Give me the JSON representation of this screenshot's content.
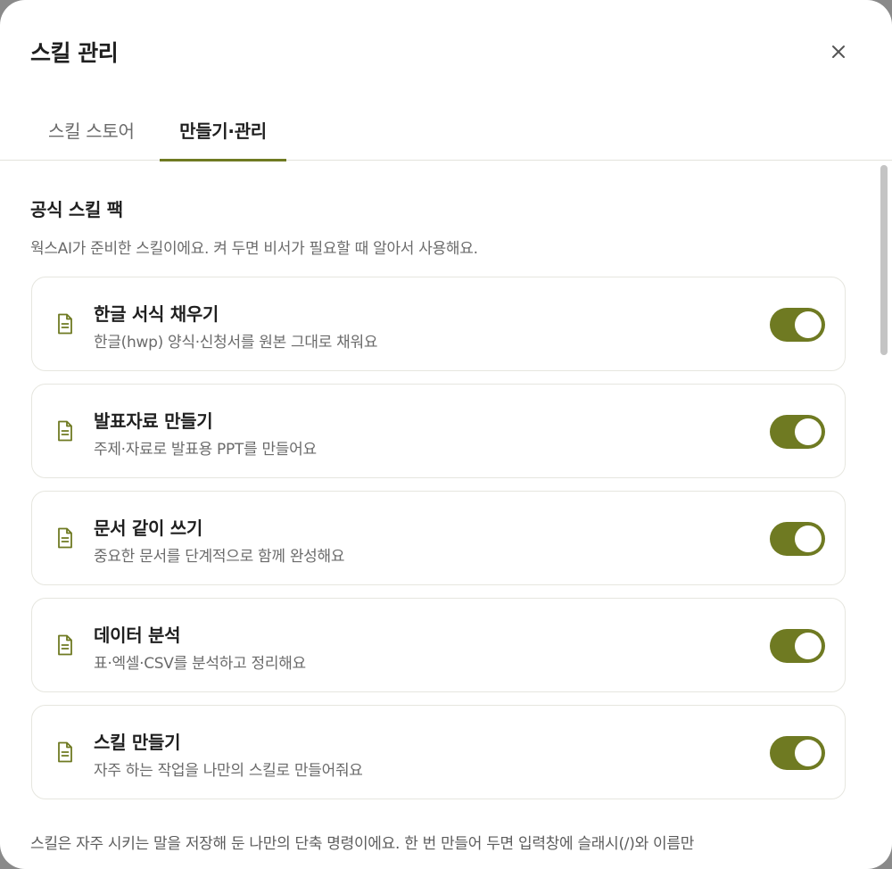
{
  "header": {
    "title": "스킬 관리",
    "close_icon": "close-icon"
  },
  "tabs": [
    {
      "label": "스킬 스토어",
      "active": false
    },
    {
      "label": "만들기·관리",
      "active": true
    }
  ],
  "section": {
    "title": "공식 스킬 팩",
    "description": "웍스AI가 준비한 스킬이에요. 켜 두면 비서가 필요할 때 알아서 사용해요."
  },
  "skills": [
    {
      "name": "한글 서식 채우기",
      "description": "한글(hwp) 양식·신청서를 원본 그대로 채워요",
      "enabled": true
    },
    {
      "name": "발표자료 만들기",
      "description": "주제·자료로 발표용 PPT를 만들어요",
      "enabled": true
    },
    {
      "name": "문서 같이 쓰기",
      "description": "중요한 문서를 단계적으로 함께 완성해요",
      "enabled": true
    },
    {
      "name": "데이터 분석",
      "description": "표·엑셀·CSV를 분석하고 정리해요",
      "enabled": true
    },
    {
      "name": "스킬 만들기",
      "description": "자주 하는 작업을 나만의 스킬로 만들어줘요",
      "enabled": true
    }
  ],
  "footer": {
    "text": "스킬은 자주 시키는 말을 저장해 둔 나만의 단축 명령이에요. 한 번 만들어 두면 입력창에 슬래시(/)와 이름만"
  },
  "colors": {
    "accent": "#6f7a22",
    "text_primary": "#1f1f1f",
    "text_secondary": "#6b6b6b",
    "border": "#e6e6df"
  },
  "icons": {
    "skill": "document-icon",
    "close": "close-icon"
  }
}
